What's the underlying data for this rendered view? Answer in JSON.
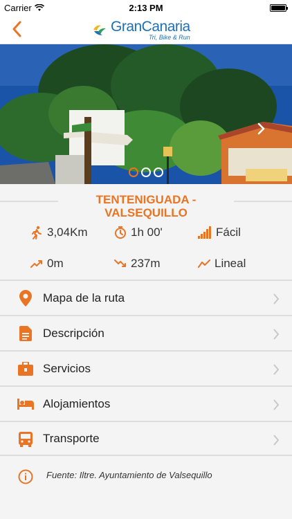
{
  "status_bar": {
    "carrier": "Carrier",
    "time": "2:13 PM"
  },
  "nav": {
    "brand": "GranCanaria",
    "tagline": "Tri, Bike & Run"
  },
  "hero": {
    "slides": 3,
    "active_slide": 1
  },
  "route": {
    "title": "TENTENIGUADA - VALSEQUILLO",
    "distance": "3,04Km",
    "time": "1h 00'",
    "difficulty": "Fácil",
    "ascent": "0m",
    "descent": "237m",
    "type": "Lineal"
  },
  "menu": [
    {
      "label": "Mapa de la ruta",
      "icon": "map-pin-icon"
    },
    {
      "label": "Descripción",
      "icon": "document-icon"
    },
    {
      "label": "Servicios",
      "icon": "briefcase-icon"
    },
    {
      "label": "Alojamientos",
      "icon": "bed-icon"
    },
    {
      "label": "Transporte",
      "icon": "bus-icon"
    }
  ],
  "footer": {
    "source": "Fuente: Iltre. Ayuntamiento de Valsequillo",
    "icon": "info-icon"
  },
  "colors": {
    "accent": "#e87424",
    "brand_blue": "#1f6fb3",
    "background": "#f4f4f4"
  }
}
